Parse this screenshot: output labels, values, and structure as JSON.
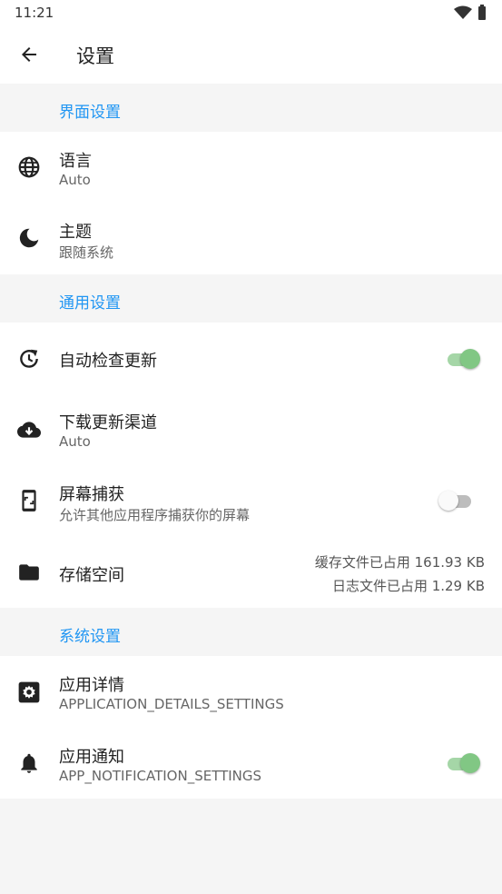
{
  "status_bar": {
    "time": "11:21",
    "wifi_icon": "wifi-icon",
    "battery_icon": "battery-icon"
  },
  "app_bar": {
    "back_icon": "arrow-back-icon",
    "title": "设置"
  },
  "sections": {
    "interface": {
      "header": "界面设置",
      "language": {
        "icon": "globe-icon",
        "title": "语言",
        "value": "Auto"
      },
      "theme": {
        "icon": "moon-icon",
        "title": "主题",
        "value": "跟随系统"
      }
    },
    "general": {
      "header": "通用设置",
      "auto_update": {
        "icon": "update-clock-icon",
        "title": "自动检查更新",
        "enabled": true
      },
      "update_channel": {
        "icon": "cloud-download-icon",
        "title": "下载更新渠道",
        "value": "Auto"
      },
      "screen_capture": {
        "icon": "phone-screenshot-icon",
        "title": "屏幕捕获",
        "subtitle": "允许其他应用程序捕获你的屏幕",
        "enabled": false
      },
      "storage": {
        "icon": "folder-icon",
        "title": "存储空间",
        "cache": "缓存文件已占用 161.93 KB",
        "logs": "日志文件已占用 1.29 KB"
      }
    },
    "system": {
      "header": "系统设置",
      "app_details": {
        "icon": "settings-gear-icon",
        "title": "应用详情",
        "subtitle": "APPLICATION_DETAILS_SETTINGS"
      },
      "app_notifications": {
        "icon": "bell-icon",
        "title": "应用通知",
        "subtitle": "APP_NOTIFICATION_SETTINGS",
        "enabled": true
      }
    }
  },
  "colors": {
    "accent": "#2196f3",
    "toggle_on": "#81c784",
    "toggle_off": "#bdbdbd",
    "background": "#f5f5f5"
  }
}
